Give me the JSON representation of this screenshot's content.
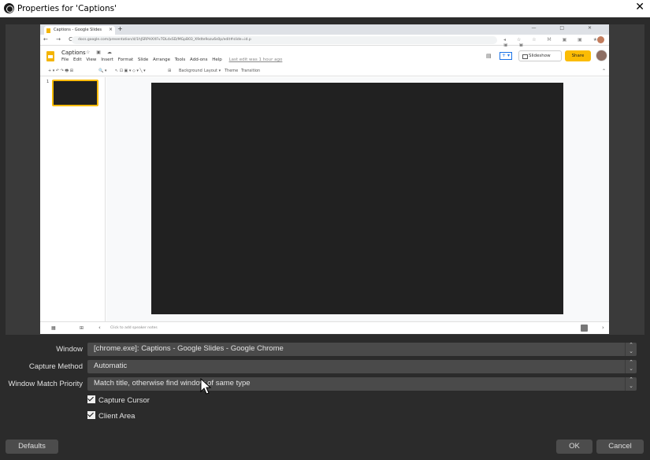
{
  "window": {
    "title": "Properties for 'Captions'",
    "close_glyph": "✕"
  },
  "browser": {
    "tab_title": "Captions - Google Slides",
    "new_tab_glyph": "+",
    "window_controls": "— □ ✕",
    "nav_glyphs": "← → C",
    "url": "docs.google.com/presentation/d/1hJSRPHXXFv7DLdxSD/MGpB03_X9dte9ozu6s0p/edit#slide=id.p",
    "ext_icons": "◂ ☆ ☆ M ▣ ▣ ★ ▣ ▣"
  },
  "slides": {
    "doc_title": "Captions",
    "title_icons": "☆ ▣ ☁",
    "menu": [
      "File",
      "Edit",
      "View",
      "Insert",
      "Format",
      "Slide",
      "Arrange",
      "Tools",
      "Add-ons",
      "Help"
    ],
    "last_edit": "Last edit was 1 hour ago",
    "comment_glyph": "▤",
    "present_glyph": "+ ▾",
    "slideshow_label": "Slideshow",
    "share_label": "Share",
    "toolbar": {
      "icons": "+ ▾ ↶ ↷ 🖶 ⊞",
      "zoom": "🔍 ▾",
      "tools": "↖ ⊡ ▣ ▾ ◇ ▾ ╲ ▾",
      "comment": "⊞",
      "background": "Background",
      "layout": "Layout ▾",
      "theme": "Theme",
      "transition": "Transition"
    },
    "slide_number": "1",
    "collapse_glyph": "⌃",
    "bottom_grid1": "▦",
    "bottom_grid2": "⊞",
    "bottom_chevron": "‹",
    "speaker_notes_placeholder": "Click to add speaker notes",
    "bottom_right": "›"
  },
  "properties": {
    "window_label": "Window",
    "window_value": "[chrome.exe]: Captions - Google Slides - Google Chrome",
    "capture_method_label": "Capture Method",
    "capture_method_value": "Automatic",
    "match_priority_label": "Window Match Priority",
    "match_priority_value": "Match title, otherwise find window of same type",
    "spin_glyph": "⌃⌄",
    "capture_cursor_label": "Capture Cursor",
    "capture_cursor_checked": true,
    "client_area_label": "Client Area",
    "client_area_checked": true
  },
  "buttons": {
    "defaults": "Defaults",
    "ok": "OK",
    "cancel": "Cancel"
  }
}
